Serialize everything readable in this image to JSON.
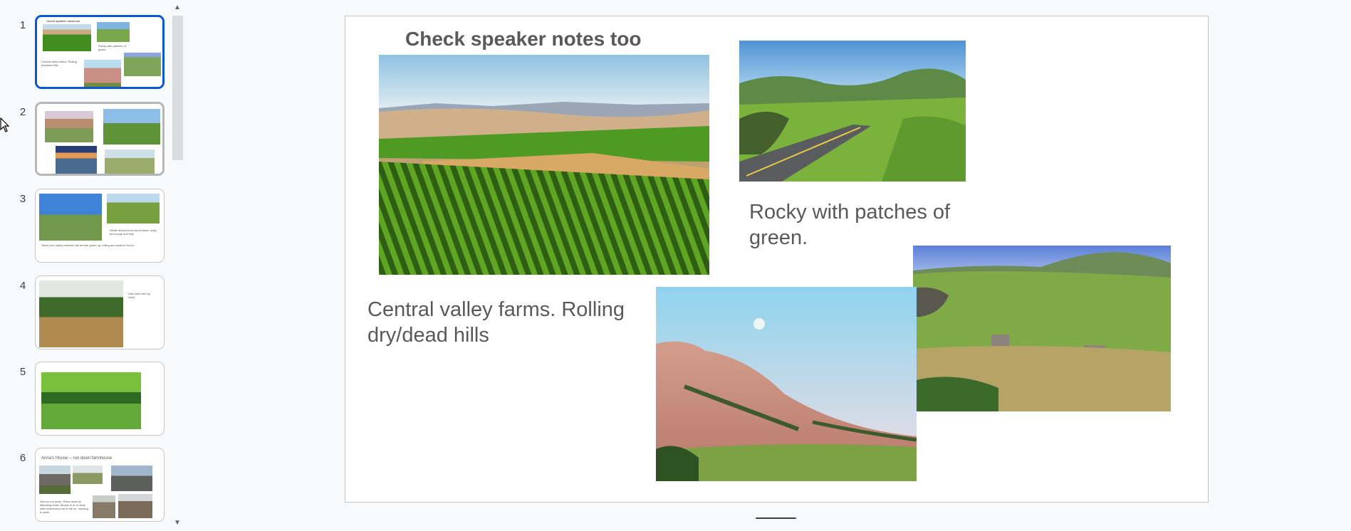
{
  "filmstrip": {
    "slides": [
      {
        "number": "1",
        "texts": [
          "Check speaker notes too",
          "Rocky with patches of green.",
          "Central valley farms. Rolling dry/dead hills"
        ]
      },
      {
        "number": "2"
      },
      {
        "number": "3",
        "texts": [
          "Winter Brown from wood show, rocky and rough and hilly",
          "Swan river valley between tall remote grass-up, rolling and small in the ho"
        ]
      },
      {
        "number": "4",
        "texts": [
          "Oak trees are my rocky"
        ]
      },
      {
        "number": "5"
      },
      {
        "number": "6",
        "texts": [
          "Anna's House -- run down farmhouse",
          "Not too run down. Place must be liberating looks. Moves in to re-work with construction as in the se, needing to peek"
        ]
      }
    ]
  },
  "slide": {
    "title": "Check speaker notes too",
    "caption_rocky": "Rocky with patches of green.",
    "caption_valley": "Central valley farms. Rolling dry/dead hills"
  },
  "images": {
    "vineyard": "vineyard-rolling-hills-photo",
    "road": "country-road-green-hills-photo",
    "pink_hills": "pink-hills-moon-photo",
    "farm": "green-hills-farm-buildings-photo"
  },
  "colors": {
    "accent": "#0b57d0",
    "caption_text": "#595959",
    "canvas_bg": "#ffffff"
  }
}
